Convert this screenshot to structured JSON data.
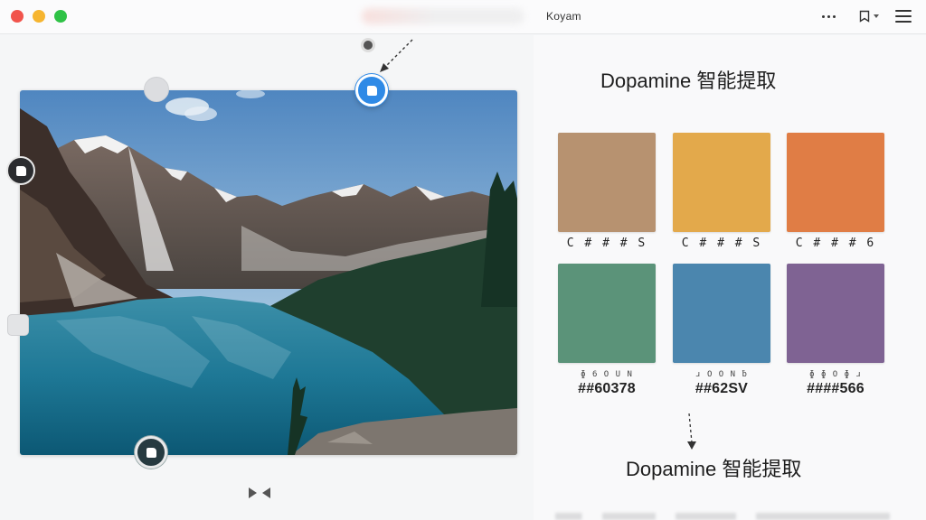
{
  "window": {
    "app_title": "Koyam"
  },
  "editor": {
    "image_alt": "Mountain lake landscape"
  },
  "panel": {
    "title": "Dopamine 智能提取",
    "title_bottom": "Dopamine 智能提取",
    "swatches": [
      {
        "color": "#b79270",
        "code": "C # # # S"
      },
      {
        "color": "#e3a94b",
        "code": "C # # # S"
      },
      {
        "color": "#e07d45",
        "code": "C # # # 6"
      },
      {
        "color": "#5b9379",
        "code_small": "ɸ 6 O U N",
        "code": "##60378"
      },
      {
        "color": "#4b86ae",
        "code_small": "ɹ O O N ƀ",
        "code": "##62SV"
      },
      {
        "color": "#7f6393",
        "code_small": "ɸ ɸ O ɸ ɹ",
        "code": "####566"
      }
    ]
  },
  "colors": {
    "accent": "#2f8ae6",
    "close": "#f1544c",
    "minimize": "#f6b530",
    "maximize": "#2fc246"
  }
}
